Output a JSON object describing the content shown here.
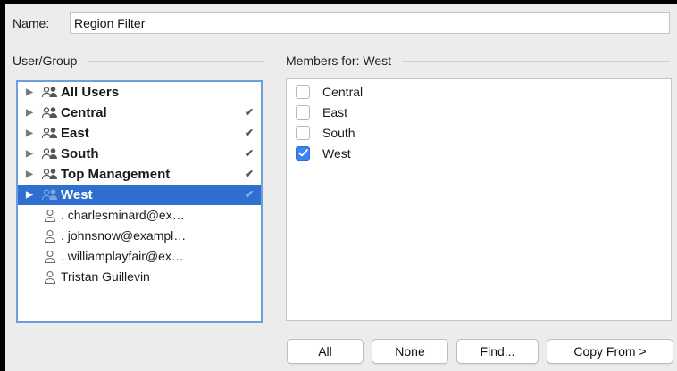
{
  "name_label": "Name:",
  "name_value": "Region Filter",
  "left_header": "User/Group",
  "right_header": "Members for: West",
  "groups": [
    {
      "label": "All Users",
      "checked": false
    },
    {
      "label": "Central",
      "checked": true
    },
    {
      "label": "East",
      "checked": true
    },
    {
      "label": "South",
      "checked": true
    },
    {
      "label": "Top Management",
      "checked": true
    },
    {
      "label": "West",
      "checked": true,
      "selected": true
    }
  ],
  "users": [
    ". charlesminard@ex…",
    ". johnsnow@exampl…",
    ". williamplayfair@ex…",
    "Tristan Guillevin"
  ],
  "members": [
    {
      "label": "Central",
      "checked": false
    },
    {
      "label": "East",
      "checked": false
    },
    {
      "label": "South",
      "checked": false
    },
    {
      "label": "West",
      "checked": true
    }
  ],
  "buttons": {
    "all": "All",
    "none": "None",
    "find": "Find...",
    "copy_from": "Copy From >"
  },
  "icons": {
    "group": "group-icon",
    "user": "user-icon",
    "expand": "triangle-right-icon",
    "check": "checkmark-icon"
  },
  "colors": {
    "selection": "#2f6fd0",
    "focus_border": "#6d9fe0",
    "checkbox_checked": "#3b82f6"
  }
}
